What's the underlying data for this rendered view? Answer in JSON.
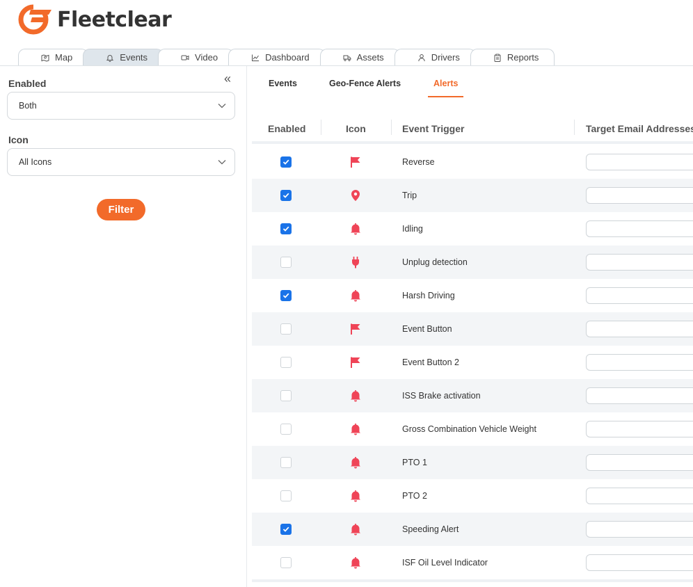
{
  "app": {
    "name": "Fleetclear",
    "brand_color": "#f26a2a",
    "accent_blue": "#1a73e8",
    "alert_red": "#ef4457"
  },
  "nav": {
    "tabs": [
      {
        "label": "Map",
        "icon": "map-icon",
        "active": false
      },
      {
        "label": "Events",
        "icon": "bell-icon",
        "active": true
      },
      {
        "label": "Video",
        "icon": "video-icon",
        "active": false
      },
      {
        "label": "Dashboard",
        "icon": "chart-icon",
        "active": false
      },
      {
        "label": "Assets",
        "icon": "truck-icon",
        "active": false
      },
      {
        "label": "Drivers",
        "icon": "person-icon",
        "active": false
      },
      {
        "label": "Reports",
        "icon": "clipboard-icon",
        "active": false
      }
    ]
  },
  "sidebar": {
    "collapse_icon": "«",
    "enabled_label": "Enabled",
    "enabled_value": "Both",
    "icon_label": "Icon",
    "icon_value": "All Icons",
    "filter_label": "Filter"
  },
  "subtabs": [
    {
      "label": "Events",
      "active": false
    },
    {
      "label": "Geo-Fence Alerts",
      "active": false
    },
    {
      "label": "Alerts",
      "active": true
    }
  ],
  "table": {
    "headers": {
      "enabled": "Enabled",
      "icon": "Icon",
      "trigger": "Event Trigger",
      "emails": "Target Email Addresses"
    },
    "rows": [
      {
        "enabled": true,
        "icon": "flag-icon",
        "trigger": "Reverse"
      },
      {
        "enabled": true,
        "icon": "pin-icon",
        "trigger": "Trip"
      },
      {
        "enabled": true,
        "icon": "bell-icon",
        "trigger": "Idling"
      },
      {
        "enabled": false,
        "icon": "plug-icon",
        "trigger": "Unplug detection"
      },
      {
        "enabled": true,
        "icon": "bell-icon",
        "trigger": "Harsh Driving"
      },
      {
        "enabled": false,
        "icon": "flag-icon",
        "trigger": "Event Button"
      },
      {
        "enabled": false,
        "icon": "flag-icon",
        "trigger": "Event Button 2"
      },
      {
        "enabled": false,
        "icon": "bell-icon",
        "trigger": "ISS Brake activation"
      },
      {
        "enabled": false,
        "icon": "bell-icon",
        "trigger": "Gross Combination Vehicle Weight"
      },
      {
        "enabled": false,
        "icon": "bell-icon",
        "trigger": "PTO 1"
      },
      {
        "enabled": false,
        "icon": "bell-icon",
        "trigger": "PTO 2"
      },
      {
        "enabled": true,
        "icon": "bell-icon",
        "trigger": "Speeding Alert"
      },
      {
        "enabled": false,
        "icon": "bell-icon",
        "trigger": "ISF Oil Level Indicator"
      }
    ]
  }
}
